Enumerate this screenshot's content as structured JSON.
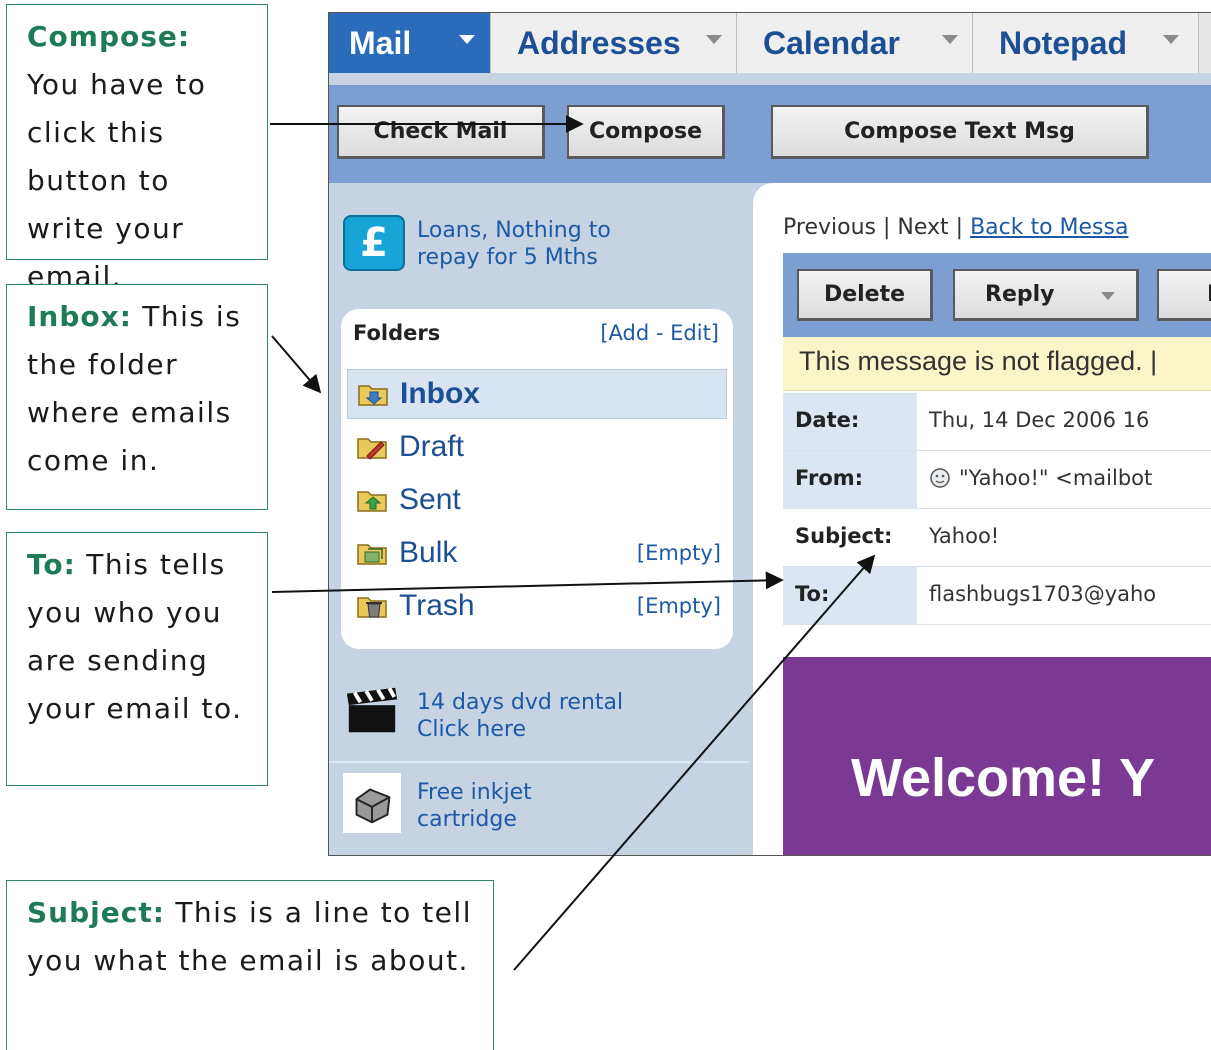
{
  "callouts": {
    "compose": {
      "term": "Compose:",
      "text": " You have to click this button to write your email."
    },
    "inbox": {
      "term": "Inbox:",
      "text": " This is the folder where emails come in."
    },
    "to": {
      "term": "To:",
      "text": " This tells you who you are sending your email to."
    },
    "subject": {
      "term": "Subject:",
      "text": " This is a line to tell you what the email is about."
    }
  },
  "tabs": [
    {
      "label": "Mail",
      "active": true
    },
    {
      "label": "Addresses",
      "active": false
    },
    {
      "label": "Calendar",
      "active": false
    },
    {
      "label": "Notepad",
      "active": false
    }
  ],
  "toolbar": {
    "check_mail": "Check Mail",
    "compose": "Compose",
    "compose_text": "Compose Text Msg"
  },
  "promos": {
    "loans": {
      "icon": "£",
      "line1": "Loans, Nothing to",
      "line2": "repay for 5 Mths"
    },
    "dvd": {
      "line1": "14 days dvd rental",
      "line2": "Click here"
    },
    "inkjet": {
      "line1": "Free inkjet",
      "line2": "cartridge"
    }
  },
  "folders": {
    "header": "Folders",
    "add_edit": "[Add - Edit]",
    "items": [
      {
        "label": "Inbox",
        "icon": "inbox-folder-icon",
        "active": true,
        "empty": ""
      },
      {
        "label": "Draft",
        "icon": "draft-folder-icon",
        "active": false,
        "empty": ""
      },
      {
        "label": "Sent",
        "icon": "sent-folder-icon",
        "active": false,
        "empty": ""
      },
      {
        "label": "Bulk",
        "icon": "bulk-folder-icon",
        "active": false,
        "empty": "[Empty]"
      },
      {
        "label": "Trash",
        "icon": "trash-folder-icon",
        "active": false,
        "empty": "[Empty]"
      }
    ]
  },
  "message": {
    "nav": {
      "previous": "Previous",
      "sep1": " | ",
      "next": "Next",
      "sep2": " | ",
      "back": "Back to Messa"
    },
    "buttons": {
      "delete": "Delete",
      "reply": "Reply",
      "forward": "F"
    },
    "flag_text": "This message is not flagged. |",
    "headers": [
      {
        "label": "Date:",
        "value": "Thu, 14 Dec 2006 16"
      },
      {
        "label": "From:",
        "value": "\"Yahoo!\" <mailbot"
      },
      {
        "label": "Subject:",
        "value": "Yahoo!"
      },
      {
        "label": "To:",
        "value": "flashbugs1703@yaho"
      }
    ],
    "welcome": "Welcome! Y"
  },
  "colors": {
    "accent_green": "#1f7a58",
    "tab_blue": "#2a6bbb",
    "toolbar_blue": "#7c9ed0",
    "banner_purple": "#7a3a93"
  }
}
